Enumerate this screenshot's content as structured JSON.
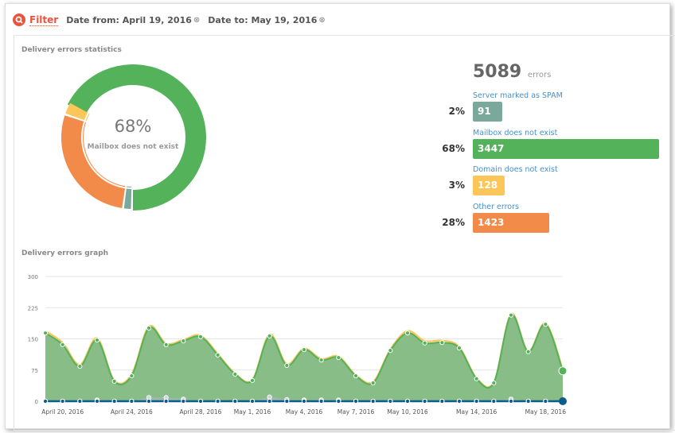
{
  "filter": {
    "label": "Filter",
    "date_from": "Date from: April 19, 2016",
    "date_to": "Date to: May 19, 2016",
    "clear_icon": "circle-x-icon",
    "search_icon": "search-icon"
  },
  "stats": {
    "title": "Delivery errors statistics",
    "center_pct": "68%",
    "center_label": "Mailbox does not exist",
    "total": "5089",
    "total_unit": "errors",
    "items": [
      {
        "label": "Server marked as SPAM",
        "pct": "2%",
        "count": "91",
        "color": "#7aa89a",
        "share": 0.02
      },
      {
        "label": "Mailbox does not exist",
        "pct": "68%",
        "count": "3447",
        "color": "#53b25a",
        "share": 0.68
      },
      {
        "label": "Domain does not exist",
        "pct": "3%",
        "count": "128",
        "color": "#fdc65a",
        "share": 0.03
      },
      {
        "label": "Other errors",
        "pct": "28%",
        "count": "1423",
        "color": "#f28b4a",
        "share": 0.28
      }
    ]
  },
  "chart_data": {
    "type": "area",
    "title": "Delivery errors graph",
    "ylim": [
      0,
      300
    ],
    "yticks": [
      "0",
      "75",
      "150",
      "225",
      "300"
    ],
    "grid": true,
    "x_labels": [
      "April 20, 2016",
      "April 24, 2016",
      "April 28, 2016",
      "May 1, 2016",
      "May 4, 2016",
      "May 7, 2016",
      "May 10, 2016",
      "May 14, 2016",
      "May 18, 2016"
    ],
    "x_label_index": [
      1,
      5,
      9,
      12,
      15,
      18,
      21,
      25,
      29
    ],
    "series": [
      {
        "key": "mailbox",
        "color": "#53b25a",
        "values": [
          164,
          136,
          84,
          147,
          48,
          61,
          176,
          136,
          145,
          155,
          111,
          65,
          50,
          157,
          86,
          124,
          99,
          105,
          61,
          44,
          122,
          164,
          140,
          141,
          128,
          54,
          44,
          207,
          119,
          185,
          73
        ]
      },
      {
        "key": "domain",
        "color": "#fdc65a",
        "values": [
          5,
          5,
          4,
          5,
          2,
          4,
          4,
          3,
          3,
          3,
          3,
          2,
          2,
          4,
          4,
          3,
          3,
          3,
          2,
          3,
          3,
          5,
          5,
          5,
          3,
          2,
          2,
          3,
          2,
          3,
          4
        ]
      },
      {
        "key": "spam",
        "color": "#a9b8c4",
        "values": [
          0,
          0,
          0,
          3,
          0,
          0,
          9,
          9,
          5,
          0,
          0,
          0,
          0,
          10,
          4,
          3,
          3,
          3,
          0,
          0,
          0,
          0,
          0,
          0,
          0,
          0,
          0,
          5,
          0,
          0,
          0
        ]
      },
      {
        "key": "other",
        "color": "#0d5d8a",
        "values": [
          0,
          0,
          0,
          0,
          0,
          0,
          0,
          0,
          0,
          0,
          0,
          0,
          0,
          0,
          0,
          0,
          0,
          0,
          0,
          0,
          0,
          0,
          0,
          0,
          0,
          0,
          0,
          0,
          0,
          0,
          0
        ]
      }
    ]
  }
}
